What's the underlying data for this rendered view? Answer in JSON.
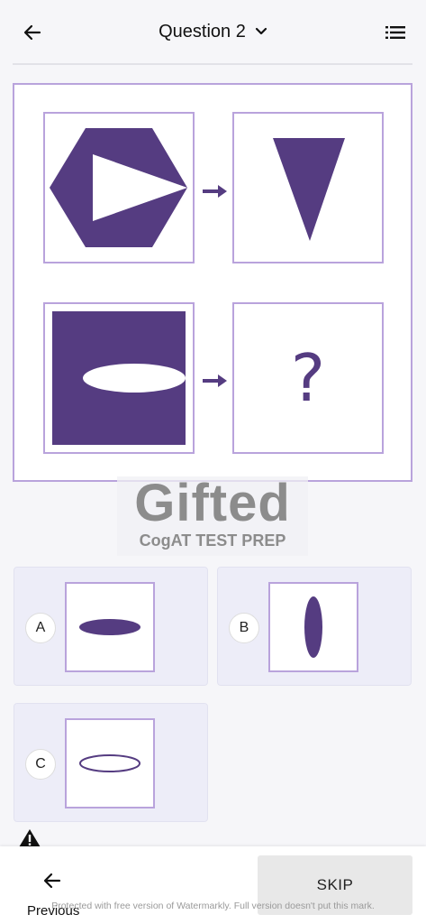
{
  "header": {
    "title": "Question 2"
  },
  "question": {
    "unknown_symbol": "?"
  },
  "watermark": {
    "brand": "Gifted",
    "tagline": "CogAT TEST PREP"
  },
  "options": [
    {
      "letter": "A",
      "shape": "filled-horizontal-ellipse"
    },
    {
      "letter": "B",
      "shape": "filled-vertical-ellipse"
    },
    {
      "letter": "C",
      "shape": "outlined-horizontal-ellipse"
    }
  ],
  "footer": {
    "previous_label": "Previous",
    "skip_label": "SKIP",
    "note": "Protected with free version of Watermarkly. Full version doesn't put this mark."
  },
  "colors": {
    "accent": "#553c81",
    "border": "#b9a3dc",
    "option_bg": "#ededf8"
  }
}
